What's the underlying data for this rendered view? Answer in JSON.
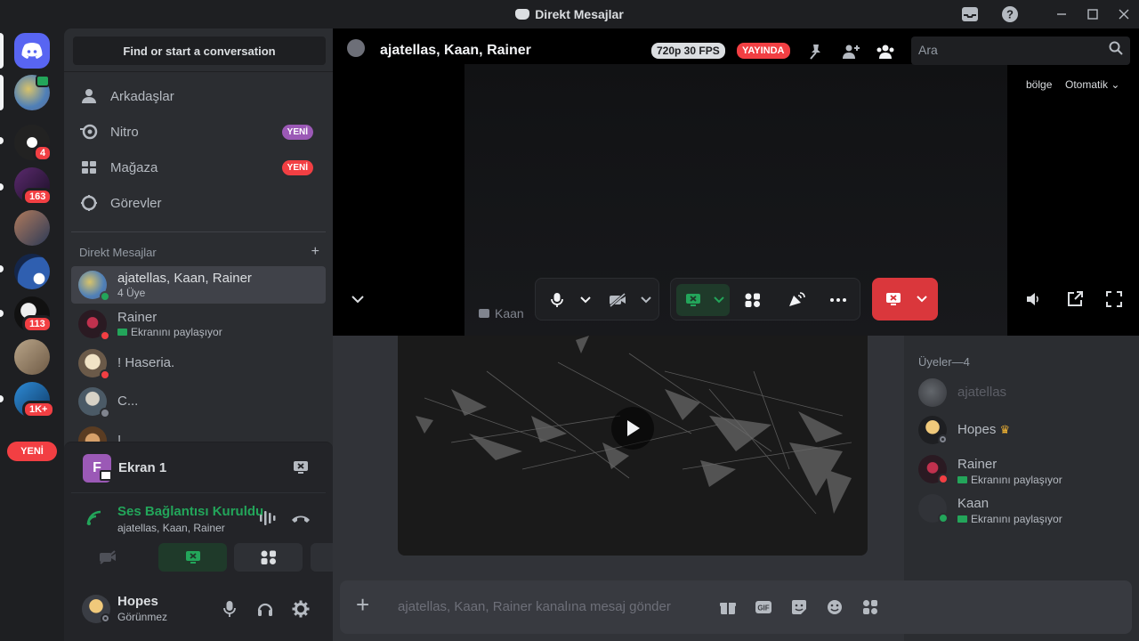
{
  "window": {
    "title": "Direkt Mesajlar",
    "controls": [
      "inbox-icon",
      "help-icon",
      "minimize-icon",
      "maximize-icon",
      "close-icon"
    ]
  },
  "guild_rail": {
    "badges": [
      "4",
      "163",
      "113",
      "1K+"
    ],
    "new_pill": "YENİ"
  },
  "sidebar": {
    "search_button": "Find or start a conversation",
    "nav": [
      {
        "label": "Arkadaşlar",
        "icon": "friends-icon"
      },
      {
        "label": "Nitro",
        "icon": "nitro-icon",
        "badge": "YENİ",
        "badge_color": "#9b59b6"
      },
      {
        "label": "Mağaza",
        "icon": "shop-icon",
        "badge": "YENİ",
        "badge_color": "#f23f43"
      },
      {
        "label": "Görevler",
        "icon": "quests-icon"
      }
    ],
    "dm_header": "Direkt Mesajlar",
    "dm_add": "+",
    "dms": [
      {
        "name": "ajatellas, Kaan, Rainer",
        "sub": "4 Üye",
        "status": "online",
        "active": true
      },
      {
        "name": "Rainer",
        "sub": "Ekranını paylaşıyor",
        "status": "dnd",
        "active": false
      },
      {
        "name": "! Haseria.",
        "sub": "",
        "status": "dnd",
        "active": false
      },
      {
        "name": "C...",
        "sub": "",
        "status": "offline",
        "active": false
      },
      {
        "name": "!",
        "sub": "",
        "status": "online",
        "active": false
      }
    ]
  },
  "voice_panel": {
    "screen_letter": "F",
    "screen_title": "Ekran 1",
    "connection_title": "Ses Bağlantısı Kuruldu",
    "connection_sub": "ajatellas, Kaan, Rainer",
    "buttons": [
      "camera-off-icon",
      "screen-share-icon",
      "activities-icon",
      "soundboard-icon"
    ]
  },
  "user": {
    "name": "Hopes",
    "status": "Görünmez"
  },
  "main": {
    "header_name": "ajatellas, Kaan, Rainer",
    "quality": "720p 30 FPS",
    "live": "YAYINDA",
    "search_placeholder": "Ara",
    "region_label": "bölge",
    "region_value": "Otomatik",
    "stream_owner": "Kaan",
    "composer_placeholder": "ajatellas, Kaan, Rainer kanalına mesaj gönder"
  },
  "members": {
    "header": "Üyeler—4",
    "list": [
      {
        "name": "ajatellas",
        "sub": "",
        "status": "none",
        "dim": true
      },
      {
        "name": "Hopes",
        "sub": "",
        "status": "invisible",
        "crown": true
      },
      {
        "name": "Rainer",
        "sub": "Ekranını paylaşıyor",
        "status": "dnd"
      },
      {
        "name": "Kaan",
        "sub": "Ekranını paylaşıyor",
        "status": "online"
      }
    ]
  },
  "colors": {
    "accent": "#5865f2",
    "online": "#23a55a",
    "dnd": "#f23f43",
    "danger": "#da373c"
  }
}
